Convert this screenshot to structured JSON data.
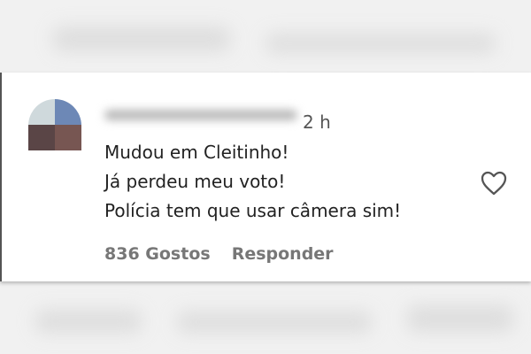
{
  "comment": {
    "timestamp": "2 h",
    "lines": [
      "Mudou em Cleitinho!",
      "Já perdeu meu voto!",
      "Polícia tem que usar câmera sim!"
    ],
    "likes_label": "836 Gostos",
    "reply_label": "Responder",
    "like_icon": "heart-outline-icon"
  },
  "colors": {
    "text": "#222222",
    "muted": "#777777",
    "card": "#ffffff",
    "background": "#f1f1f1"
  }
}
